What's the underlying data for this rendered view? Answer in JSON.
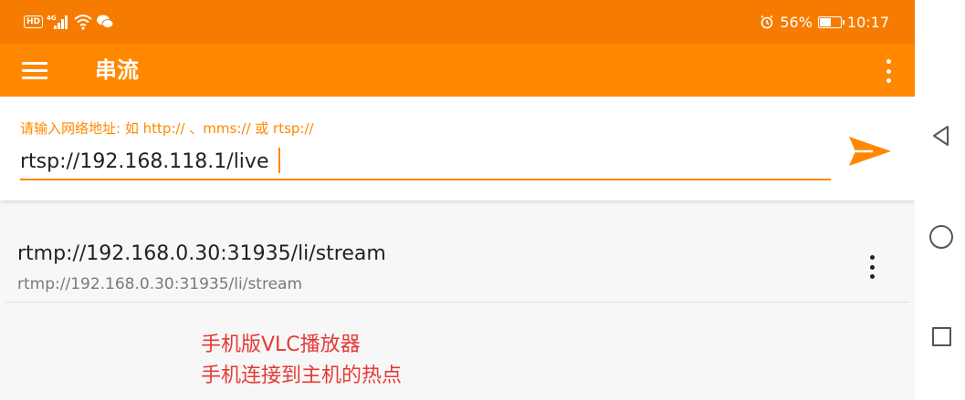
{
  "status_bar": {
    "hd_badge": "HD",
    "network": "4G",
    "battery_percent": "56%",
    "battery_level": 0.56,
    "time": "10:17",
    "icons": [
      "signal-icon",
      "wifi-icon",
      "wechat-icon",
      "alarm-icon",
      "battery-icon"
    ]
  },
  "app_bar": {
    "title": "串流",
    "icons": [
      "menu-icon",
      "overflow-menu-icon"
    ]
  },
  "stream_input": {
    "hint": "请输入网络地址: 如 http:// 、mms:// 或 rtsp://",
    "value": "rtsp://192.168.118.1/live",
    "send_icon": "send-icon"
  },
  "history": [
    {
      "title": "rtmp://192.168.0.30:31935/li/stream",
      "subtitle": "rtmp://192.168.0.30:31935/li/stream"
    }
  ],
  "annotation": {
    "line1": "手机版VLC播放器",
    "line2": "手机连接到主机的热点"
  },
  "nav_bar": {
    "icons": [
      "back-icon",
      "home-icon",
      "recent-apps-icon"
    ]
  },
  "colors": {
    "status_bar": "#f57c00",
    "app_bar": "#ff8800",
    "accent": "#ff8800",
    "annotation": "#e53935"
  }
}
